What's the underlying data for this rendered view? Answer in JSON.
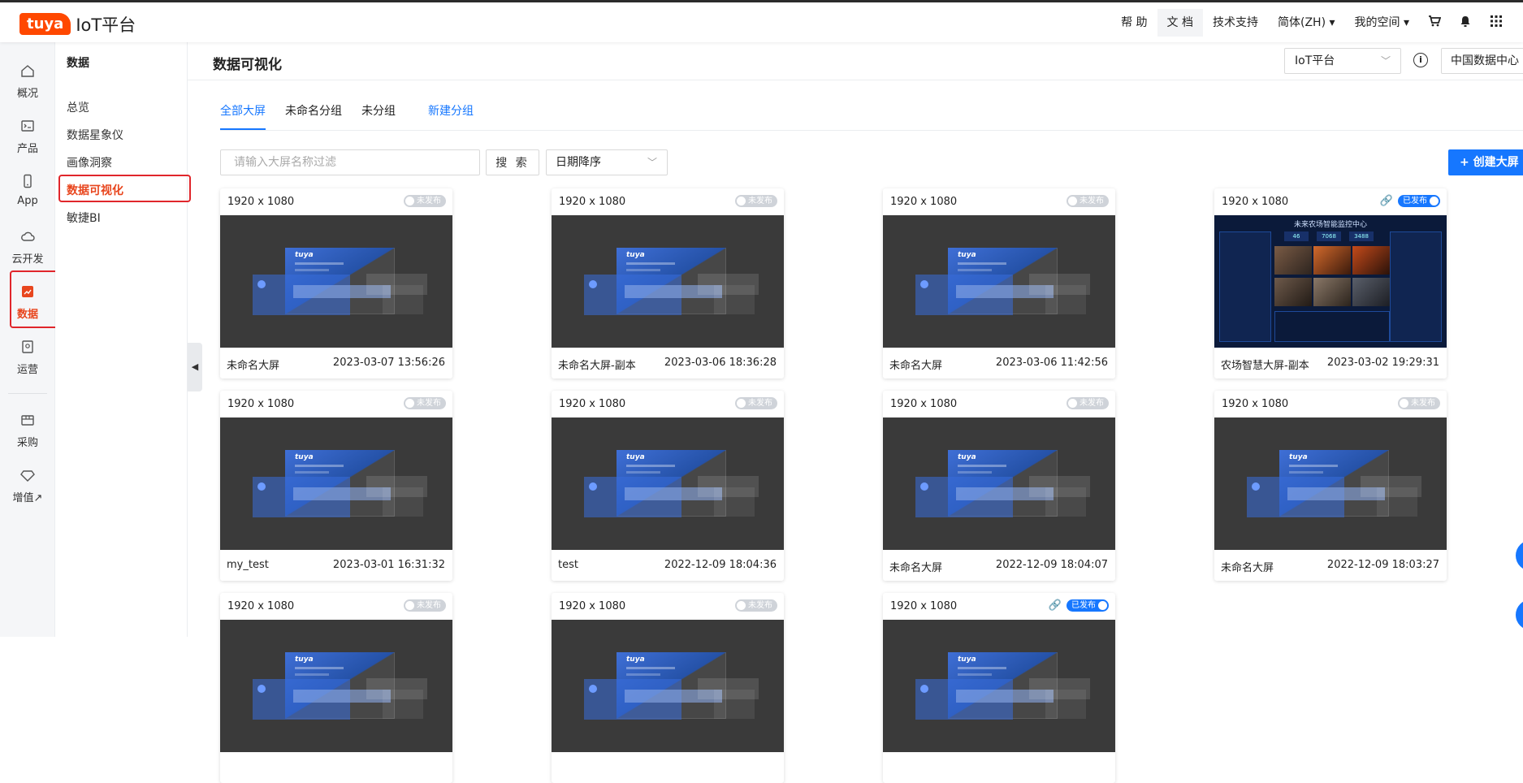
{
  "topbar": {
    "logo_badge": "tuya",
    "logo_text": "IoT平台",
    "help": "帮 助",
    "docs": "文 档",
    "support": "技术支持",
    "language": "简体(ZH) ▾",
    "space": "我的空间 ▾"
  },
  "rail": [
    {
      "label": "概况",
      "icon": "home-icon"
    },
    {
      "label": "产品",
      "icon": "terminal-icon"
    },
    {
      "label": "App",
      "icon": "phone-icon"
    },
    {
      "label": "云开发",
      "icon": "cloud-icon"
    },
    {
      "label": "数据",
      "icon": "chart-icon"
    },
    {
      "label": "运营",
      "icon": "badge-icon"
    },
    {
      "label": "采购",
      "icon": "box-icon"
    },
    {
      "label": "增值↗",
      "icon": "diamond-icon"
    }
  ],
  "submenu": {
    "title": "数据",
    "items": [
      "总览",
      "数据星象仪",
      "画像洞察",
      "数据可视化",
      "敏捷BI"
    ]
  },
  "header": {
    "title": "数据可视化",
    "platform": "IoT平台",
    "datacenter": "中国数据中心"
  },
  "tabs": {
    "all": "全部大屏",
    "unnamed": "未命名分组",
    "ungrouped": "未分组",
    "new_group": "新建分组"
  },
  "toolbar": {
    "filter_placeholder": "请输入大屏名称过滤",
    "search": "搜 索",
    "sort": "日期降序",
    "create": "+ 创建大屏"
  },
  "status": {
    "unpublished": "未发布",
    "published": "已发布"
  },
  "dashboard": {
    "title": "未来农场智能监控中心",
    "kpi": [
      "46",
      "7068",
      "3488"
    ]
  },
  "cards": [
    {
      "res": "1920 x 1080",
      "status": "unpublished",
      "name": "未命名大屏",
      "date": "2023-03-07 13:56:26"
    },
    {
      "res": "1920 x 1080",
      "status": "unpublished",
      "name": "未命名大屏-副本",
      "date": "2023-03-06 18:36:28"
    },
    {
      "res": "1920 x 1080",
      "status": "unpublished",
      "name": "未命名大屏",
      "date": "2023-03-06 11:42:56"
    },
    {
      "res": "1920 x 1080",
      "status": "published",
      "name": "农场智慧大屏-副本",
      "date": "2023-03-02 19:29:31"
    },
    {
      "res": "1920 x 1080",
      "status": "unpublished",
      "name": "my_test",
      "date": "2023-03-01 16:31:32"
    },
    {
      "res": "1920 x 1080",
      "status": "unpublished",
      "name": "test",
      "date": "2022-12-09 18:04:36"
    },
    {
      "res": "1920 x 1080",
      "status": "unpublished",
      "name": "未命名大屏",
      "date": "2022-12-09 18:04:07"
    },
    {
      "res": "1920 x 1080",
      "status": "unpublished",
      "name": "未命名大屏",
      "date": "2022-12-09 18:03:27"
    },
    {
      "res": "1920 x 1080",
      "status": "unpublished",
      "name": "",
      "date": ""
    },
    {
      "res": "1920 x 1080",
      "status": "unpublished",
      "name": "",
      "date": ""
    },
    {
      "res": "1920 x 1080",
      "status": "published",
      "name": "",
      "date": ""
    }
  ],
  "colors": {
    "accent": "#1677ff",
    "brand": "#ff4800",
    "selected": "#e8461e",
    "highlight_box": "#e0262b"
  }
}
